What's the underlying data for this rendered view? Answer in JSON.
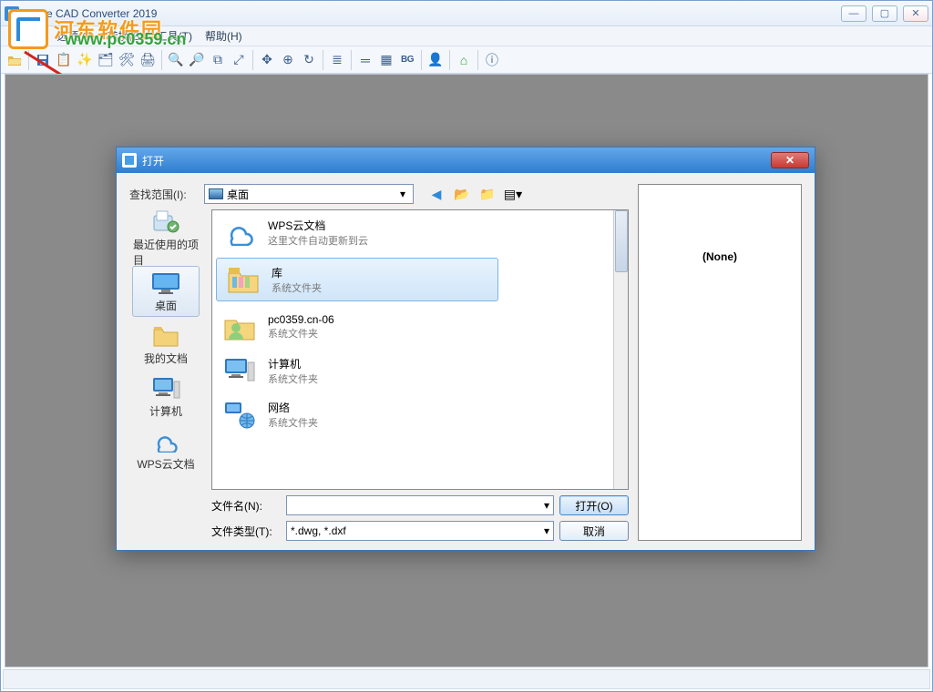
{
  "app": {
    "title": "Acme CAD Converter 2019"
  },
  "watermark": {
    "brand": "河东软件园",
    "url": "www.pc0359.cn"
  },
  "menu": {
    "file": "文件(F)",
    "options": "选项(O)",
    "convert": "转换(B)",
    "tools": "工具(T)",
    "help": "帮助(H)"
  },
  "toolbar_bg": "BG",
  "dialog": {
    "title": "打开",
    "lookin_label": "查找范围(I):",
    "lookin_value": "桌面",
    "preview_text": "(None)",
    "filename_label": "文件名(N):",
    "filename_value": "",
    "filetype_label": "文件类型(T):",
    "filetype_value": "*.dwg, *.dxf",
    "open_btn": "打开(O)",
    "cancel_btn": "取消"
  },
  "places": [
    {
      "key": "recent",
      "label": "最近使用的项目"
    },
    {
      "key": "desktop",
      "label": "桌面"
    },
    {
      "key": "mydocs",
      "label": "我的文档"
    },
    {
      "key": "computer",
      "label": "计算机"
    },
    {
      "key": "wps",
      "label": "WPS云文档"
    }
  ],
  "files": [
    {
      "name": "WPS云文档",
      "sub": "这里文件自动更新到云",
      "icon": "cloud"
    },
    {
      "name": "库",
      "sub": "系统文件夹",
      "icon": "lib",
      "selected": true
    },
    {
      "name": "pc0359.cn-06",
      "sub": "系统文件夹",
      "icon": "user"
    },
    {
      "name": "计算机",
      "sub": "系统文件夹",
      "icon": "computer"
    },
    {
      "name": "网络",
      "sub": "系统文件夹",
      "icon": "network"
    }
  ]
}
